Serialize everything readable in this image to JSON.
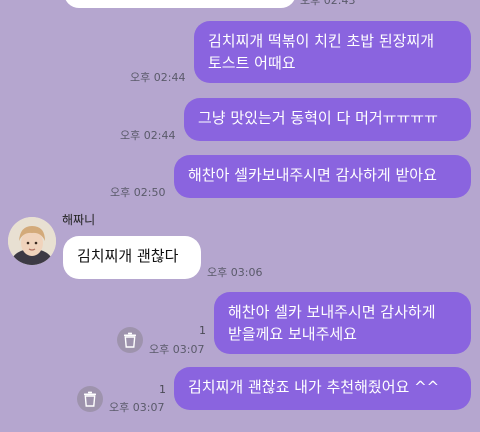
{
  "chat": {
    "top_partial_time": "오후 02:43",
    "messages": [
      {
        "text_line1": "김치찌개 떡볶이 치킨 초밥 된장찌개",
        "text_line2": "토스트 어때요",
        "time": "오후 02:44"
      },
      {
        "text": "그냥 맛있는거 동혁이 다 머거ㅠㅠㅠㅠ",
        "time": "오후 02:44"
      },
      {
        "text": "해찬아 셀카보내주시면 감사하게 받아요",
        "time": "오후 02:50"
      },
      {
        "sender": "해짜니",
        "text": "김치찌개 괜찮다",
        "time": "오후 03:06"
      },
      {
        "text_line1": "해찬아 셀카 보내주시면 감사하게",
        "text_line2": "받을께요 보내주세요",
        "time": "오후 03:07",
        "unread": "1"
      },
      {
        "text": "김치찌개 괜찮죠 내가 추천해줬어요 ^^",
        "time": "오후 03:07",
        "unread": "1"
      }
    ]
  },
  "colors": {
    "background": "#b5a6cf",
    "outgoing_bubble": "#8a64df",
    "incoming_bubble": "#ffffff"
  },
  "icons": {
    "delete": "trash-icon",
    "avatar": "profile-avatar"
  }
}
